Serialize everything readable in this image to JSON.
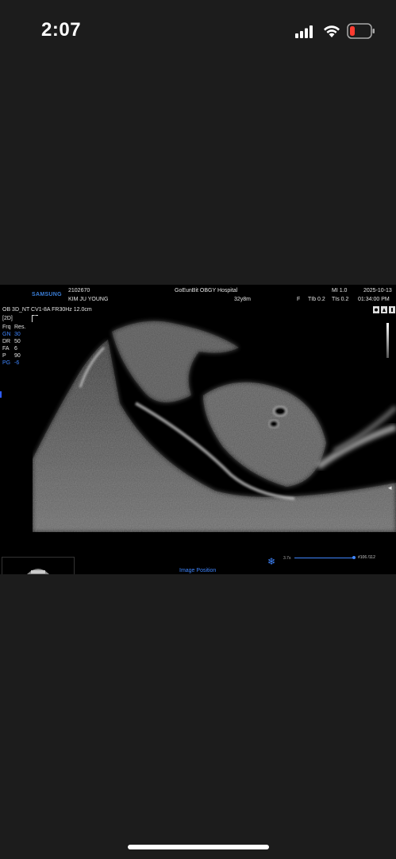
{
  "status_bar": {
    "time": "2:07"
  },
  "header": {
    "brand": "SAMSUNG",
    "patient_id": "2102670",
    "patient_name": "KIM JU YOUNG",
    "hospital": "GoEunBit OBGY Hospital",
    "age": "32y8m",
    "mi": "MI  1.0",
    "date": "2025-10-13",
    "sex": "F",
    "tib": "TIb 0.2",
    "tis": "TIs 0.2",
    "time": "01:34:00 PM",
    "preset": "OB  3D_NT  CV1-8A  FR30Hz  12.0cm"
  },
  "params": {
    "mode": "[2D]",
    "frq_label": "Frq",
    "frq_value": "Res.",
    "gn_label": "GN",
    "gn_value": "30",
    "dr_label": "DR",
    "dr_value": "50",
    "fa_label": "FA",
    "fa_value": "6",
    "p_label": "P",
    "p_value": "90",
    "pg_label": "PG",
    "pg_value": "-6"
  },
  "footer": {
    "image_position": "Image Position",
    "cine_left": "3.7s",
    "cine_right": "#106 /112"
  },
  "icons": [
    "signal-icon",
    "wifi-icon",
    "battery-icon",
    "snowflake-icon",
    "s-icon"
  ],
  "colors": {
    "accent": "#3f86ff",
    "battery_low": "#ff3b30",
    "background": "#1c1c1c"
  }
}
